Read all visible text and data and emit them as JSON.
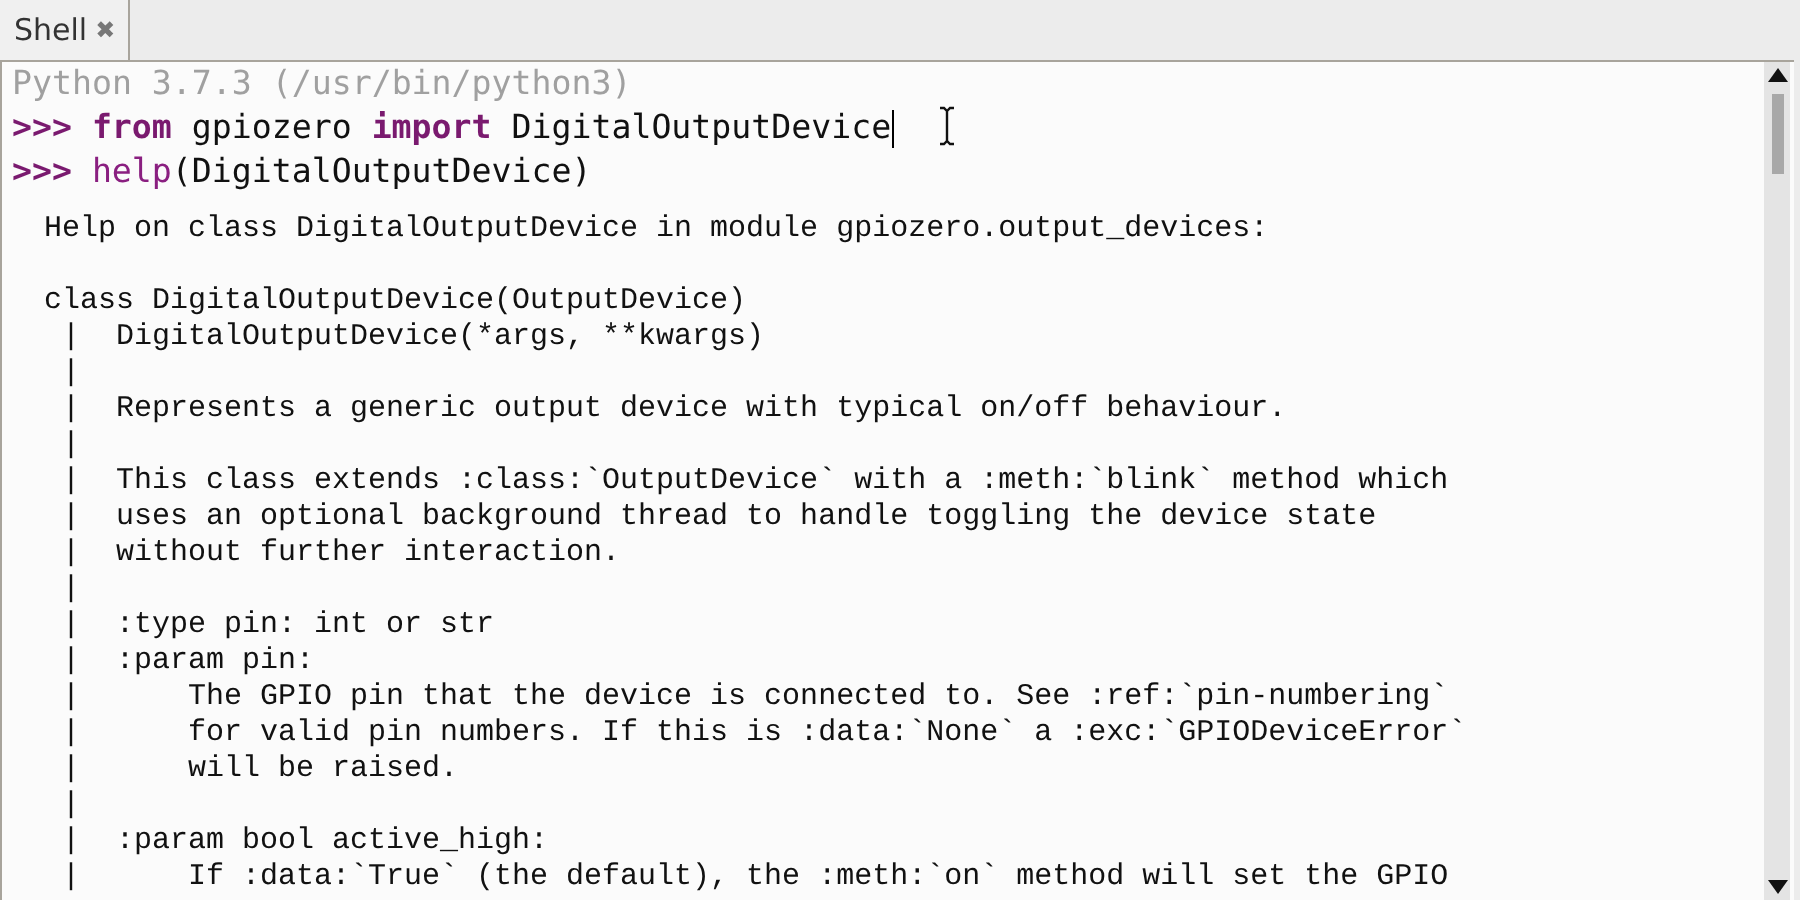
{
  "tabs": [
    {
      "label": "Shell",
      "close": "✖",
      "selected": true
    }
  ],
  "shell": {
    "banner": "Python 3.7.3 (/usr/bin/python3)",
    "commands": [
      {
        "prompt": ">>>",
        "segments": [
          {
            "kind": "keyword",
            "text": "from"
          },
          {
            "kind": "plain",
            "text": " gpiozero "
          },
          {
            "kind": "keyword",
            "text": "import"
          },
          {
            "kind": "plain",
            "text": " DigitalOutputDevice"
          }
        ],
        "caret": true
      },
      {
        "prompt": ">>>",
        "segments": [
          {
            "kind": "builtin",
            "text": "help"
          },
          {
            "kind": "plain",
            "text": "(DigitalOutputDevice)"
          }
        ],
        "caret": false
      }
    ],
    "output": [
      [
        "Help on class DigitalOutputDevice in module gpiozero.output_devices:"
      ],
      [
        "class DigitalOutputDevice(OutputDevice)",
        " |  DigitalOutputDevice(*args, **kwargs)",
        " |",
        " |  Represents a generic output device with typical on/off behaviour.",
        " |",
        " |  This class extends :class:`OutputDevice` with a :meth:`blink` method which",
        " |  uses an optional background thread to handle toggling the device state",
        " |  without further interaction.",
        " |",
        " |  :type pin: int or str",
        " |  :param pin:",
        " |      The GPIO pin that the device is connected to. See :ref:`pin-numbering`",
        " |      for valid pin numbers. If this is :data:`None` a :exc:`GPIODeviceError`",
        " |      will be raised.",
        " |",
        " |  :param bool active_high:",
        " |      If :data:`True` (the default), the :meth:`on` method will set the GPIO"
      ]
    ]
  }
}
